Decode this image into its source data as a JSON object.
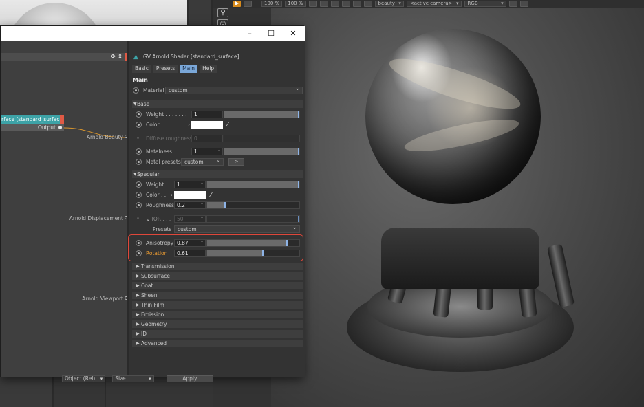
{
  "viewport_toolbar": {
    "zoom1": "100 %",
    "zoom2": "100 %",
    "pass": "beauty",
    "camera": "<active camera>",
    "colorspace": "RGB"
  },
  "window": {
    "minimize": "–",
    "maximize": "☐",
    "close": "✕"
  },
  "graph": {
    "node_title": "rface (standard_surface)",
    "node_output": "Output",
    "inputs": [
      "Arnold Beauty",
      "Arnold Displacement",
      "Arnold Viewport"
    ]
  },
  "bottom_bar": {
    "mode": "Object (Rel)",
    "size": "Size",
    "apply": "Apply"
  },
  "attributes": {
    "header": "GV Arnold Shader [standard_surface]",
    "tabs": [
      "Basic",
      "Presets",
      "Main",
      "Help"
    ],
    "active_tab": "Main",
    "section": "Main",
    "material_label": "Material",
    "material_value": "custom",
    "base": {
      "title": "Base",
      "weight_label": "Weight . . . . . . .",
      "weight_value": "1",
      "weight_fraction": 1.0,
      "color_label": "Color . . . . . . . .",
      "color_hex": "#ffffff",
      "diffuse_roughness_label": "Diffuse roughness",
      "diffuse_roughness_value": "0",
      "metalness_label": "Metalness . . . . .",
      "metalness_value": "1",
      "metalness_fraction": 1.0,
      "metal_presets_label": "Metal presets",
      "metal_presets_value": "custom",
      "metal_presets_button": ">"
    },
    "specular": {
      "title": "Specular",
      "weight_label": "Weight . .",
      "weight_value": "1",
      "weight_fraction": 1.0,
      "color_label": "Color . .",
      "color_hex": "#ffffff",
      "roughness_label": "Roughness",
      "roughness_value": "0.2",
      "roughness_fraction": 0.2,
      "ior_label": "IOR . . .",
      "ior_value": "50",
      "presets_label": "Presets",
      "presets_value": "custom",
      "anisotropy_label": "Anisotropy",
      "anisotropy_value": "0.87",
      "anisotropy_fraction": 0.87,
      "rotation_label": "Rotation",
      "rotation_value": "0.61",
      "rotation_fraction": 0.61
    },
    "groups": [
      "Transmission",
      "Subsurface",
      "Coat",
      "Sheen",
      "Thin Film",
      "Emission",
      "Geometry",
      "ID",
      "Advanced"
    ]
  },
  "colors": {
    "node_teal": "#3da3a7",
    "accent_red": "#e05a45",
    "highlight_red": "#e0473a",
    "active_tab": "#7aa7d8",
    "rotation_label": "#e89a32",
    "wire": "#d9962e"
  }
}
